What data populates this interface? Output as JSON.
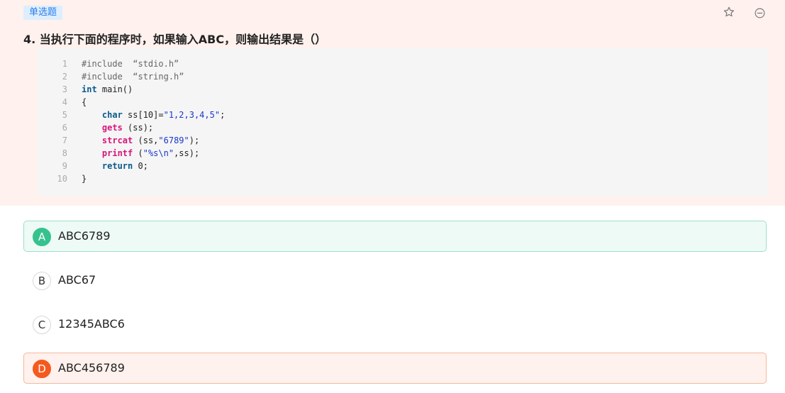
{
  "question": {
    "type_tag": "单选题",
    "title": "4. 当执行下面的程序时，如果输入ABC，则输出结果是（）",
    "icons": [
      "star-icon",
      "minus-circle-icon"
    ]
  },
  "code": {
    "lines": [
      {
        "n": "1",
        "segments": [
          {
            "t": "#include  “stdio.h”",
            "c": "pp"
          }
        ]
      },
      {
        "n": "2",
        "segments": [
          {
            "t": "#include  “string.h”",
            "c": "pp"
          }
        ]
      },
      {
        "n": "3",
        "segments": [
          {
            "t": "int",
            "c": "kw"
          },
          {
            "t": " main()",
            "c": "plain"
          }
        ]
      },
      {
        "n": "4",
        "segments": [
          {
            "t": "{",
            "c": "plain"
          }
        ]
      },
      {
        "n": "5",
        "segments": [
          {
            "t": "    ",
            "c": "plain"
          },
          {
            "t": "char",
            "c": "kw"
          },
          {
            "t": " ss[10]=",
            "c": "plain"
          },
          {
            "t": "\"1,2,3,4,5\"",
            "c": "str"
          },
          {
            "t": ";",
            "c": "plain"
          }
        ]
      },
      {
        "n": "6",
        "segments": [
          {
            "t": "    ",
            "c": "plain"
          },
          {
            "t": "gets",
            "c": "fn"
          },
          {
            "t": " (ss);",
            "c": "plain"
          }
        ]
      },
      {
        "n": "7",
        "segments": [
          {
            "t": "    ",
            "c": "plain"
          },
          {
            "t": "strcat",
            "c": "fn"
          },
          {
            "t": " (ss,",
            "c": "plain"
          },
          {
            "t": "\"6789\"",
            "c": "str"
          },
          {
            "t": ");",
            "c": "plain"
          }
        ]
      },
      {
        "n": "8",
        "segments": [
          {
            "t": "    ",
            "c": "plain"
          },
          {
            "t": "printf",
            "c": "fn"
          },
          {
            "t": " (",
            "c": "plain"
          },
          {
            "t": "\"%s\\n\"",
            "c": "str"
          },
          {
            "t": ",ss);",
            "c": "plain"
          }
        ]
      },
      {
        "n": "9",
        "segments": [
          {
            "t": "    ",
            "c": "plain"
          },
          {
            "t": "return",
            "c": "kw"
          },
          {
            "t": " 0;",
            "c": "plain"
          }
        ]
      },
      {
        "n": "10",
        "segments": [
          {
            "t": "}",
            "c": "plain"
          }
        ]
      }
    ]
  },
  "options": [
    {
      "letter": "A",
      "text": "ABC6789",
      "state": "correct"
    },
    {
      "letter": "B",
      "text": "ABC67",
      "state": "normal"
    },
    {
      "letter": "C",
      "text": "12345ABC6",
      "state": "normal"
    },
    {
      "letter": "D",
      "text": "ABC456789",
      "state": "wrong"
    }
  ],
  "colors": {
    "panel_bg": "#fff1ed",
    "correct": "#36c28e",
    "wrong": "#f5591f",
    "tag_text": "#2b7de9"
  }
}
